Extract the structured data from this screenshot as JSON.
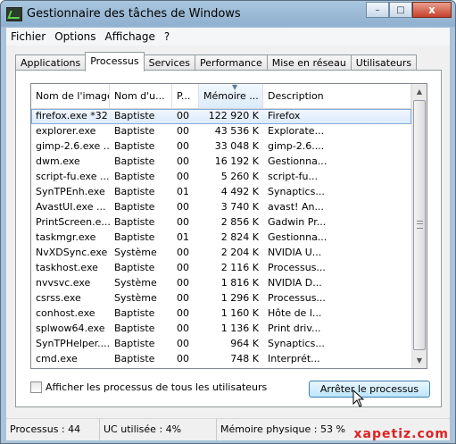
{
  "window": {
    "title": "Gestionnaire des tâches de Windows",
    "minimize_glyph": "–",
    "maximize_glyph": "□",
    "close_glyph": "x"
  },
  "menu": [
    {
      "label": "Fichier"
    },
    {
      "label": "Options"
    },
    {
      "label": "Affichage"
    },
    {
      "label": "?"
    }
  ],
  "tabs": [
    {
      "label": "Applications",
      "active": false
    },
    {
      "label": "Processus",
      "active": true
    },
    {
      "label": "Services",
      "active": false
    },
    {
      "label": "Performance",
      "active": false
    },
    {
      "label": "Mise en réseau",
      "active": false
    },
    {
      "label": "Utilisateurs",
      "active": false
    }
  ],
  "columns": [
    {
      "label": "Nom de l'image"
    },
    {
      "label": "Nom d'u..."
    },
    {
      "label": "P..."
    },
    {
      "label": "Mémoire ..."
    },
    {
      "label": "Description"
    }
  ],
  "sorted_column": 3,
  "processes": [
    {
      "name": "firefox.exe *32",
      "user": "Baptiste",
      "cpu": "00",
      "mem": "122 920 K",
      "desc": "Firefox"
    },
    {
      "name": "explorer.exe",
      "user": "Baptiste",
      "cpu": "00",
      "mem": "43 536 K",
      "desc": "Explorate..."
    },
    {
      "name": "gimp-2.6.exe ...",
      "user": "Baptiste",
      "cpu": "00",
      "mem": "33 048 K",
      "desc": "gimp-2.6...."
    },
    {
      "name": "dwm.exe",
      "user": "Baptiste",
      "cpu": "00",
      "mem": "16 192 K",
      "desc": "Gestionna..."
    },
    {
      "name": "script-fu.exe ...",
      "user": "Baptiste",
      "cpu": "00",
      "mem": "5 260 K",
      "desc": "script-fu..."
    },
    {
      "name": "SynTPEnh.exe",
      "user": "Baptiste",
      "cpu": "01",
      "mem": "4 492 K",
      "desc": "Synaptics..."
    },
    {
      "name": "AvastUI.exe ...",
      "user": "Baptiste",
      "cpu": "00",
      "mem": "3 740 K",
      "desc": "avast! An..."
    },
    {
      "name": "PrintScreen.e...",
      "user": "Baptiste",
      "cpu": "00",
      "mem": "2 856 K",
      "desc": "Gadwin Pr..."
    },
    {
      "name": "taskmgr.exe",
      "user": "Baptiste",
      "cpu": "01",
      "mem": "2 824 K",
      "desc": "Gestionna..."
    },
    {
      "name": "NvXDSync.exe",
      "user": "Système",
      "cpu": "00",
      "mem": "2 204 K",
      "desc": "NVIDIA U..."
    },
    {
      "name": "taskhost.exe",
      "user": "Baptiste",
      "cpu": "00",
      "mem": "2 116 K",
      "desc": "Processus..."
    },
    {
      "name": "nvvsvc.exe",
      "user": "Système",
      "cpu": "00",
      "mem": "1 816 K",
      "desc": "NVIDIA D..."
    },
    {
      "name": "csrss.exe",
      "user": "Système",
      "cpu": "00",
      "mem": "1 296 K",
      "desc": "Processus..."
    },
    {
      "name": "conhost.exe",
      "user": "Baptiste",
      "cpu": "00",
      "mem": "1 160 K",
      "desc": "Hôte de l..."
    },
    {
      "name": "splwow64.exe",
      "user": "Baptiste",
      "cpu": "00",
      "mem": "1 136 K",
      "desc": "Print driv..."
    },
    {
      "name": "SynTPHelper....",
      "user": "Baptiste",
      "cpu": "00",
      "mem": "964 K",
      "desc": "Synaptics..."
    },
    {
      "name": "cmd.exe",
      "user": "Baptiste",
      "cpu": "00",
      "mem": "748 K",
      "desc": "Interprét..."
    }
  ],
  "show_all_processes_label": "Afficher les processus de tous les utilisateurs",
  "end_process_label": "Arrêter le processus",
  "status": {
    "processes": "Processus : 44",
    "cpu": "UC utilisée : 4%",
    "memory": "Mémoire physique : 53 %"
  },
  "watermark": "xapetiz.com"
}
